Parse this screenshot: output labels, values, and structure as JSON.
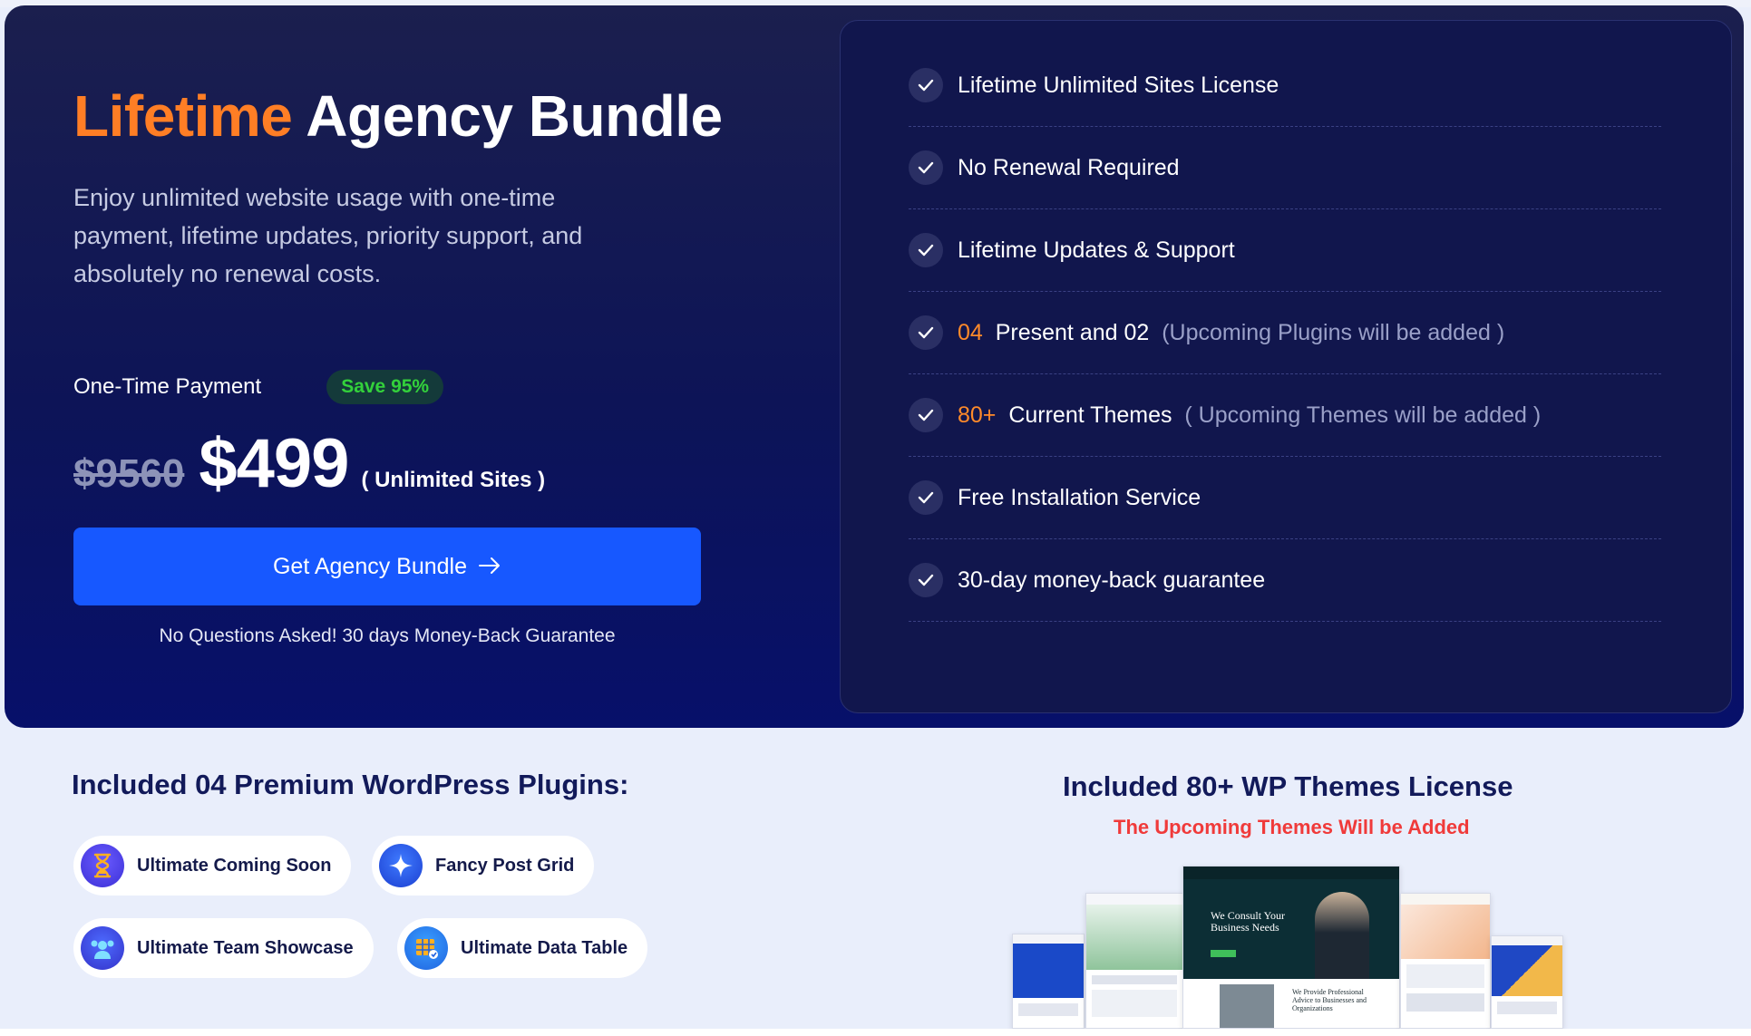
{
  "hero": {
    "title_highlight": "Lifetime",
    "title_rest": "Agency Bundle",
    "description": "Enjoy unlimited website usage with one-time payment, lifetime updates, priority support, and absolutely no renewal costs.",
    "payment_label": "One-Time Payment",
    "save_badge": "Save 95%",
    "old_price": "$9560",
    "new_price": "$499",
    "price_note": "( Unlimited Sites )",
    "cta_label": "Get Agency Bundle",
    "cta_icon": "arrow-right-icon",
    "guarantee": "No Questions Asked! 30 days Money-Back Guarantee",
    "colors": {
      "accent": "#ff7e25",
      "button": "#1758ff",
      "save_green": "#33d13b"
    }
  },
  "features": [
    {
      "text": "Lifetime Unlimited Sites License"
    },
    {
      "text": "No Renewal Required"
    },
    {
      "text": "Lifetime Updates & Support"
    },
    {
      "num": "04",
      "text": "Present and 02",
      "note": "(Upcoming Plugins will be added )"
    },
    {
      "num": "80+",
      "text": "Current Themes",
      "note": "( Upcoming Themes will be added )"
    },
    {
      "text": "Free Installation Service"
    },
    {
      "text": "30-day money-back guarantee",
      "color": "#2fd63a"
    }
  ],
  "plugins": {
    "title": "Included 04 Premium WordPress Plugins:",
    "items": [
      {
        "label": "Ultimate Coming Soon",
        "icon": "hourglass-icon"
      },
      {
        "label": "Fancy Post Grid",
        "icon": "sparkle-icon"
      },
      {
        "label": "Ultimate Team Showcase",
        "icon": "team-icon"
      },
      {
        "label": "Ultimate Data Table",
        "icon": "table-icon"
      }
    ]
  },
  "themes": {
    "title": "Included 80+ WP Themes License",
    "subtitle": "The Upcoming Themes Will be Added",
    "preview_headline": "We Consult Your Business Needs",
    "preview_subhead": "We Provide Professional Advice to Businesses and Organizations"
  }
}
